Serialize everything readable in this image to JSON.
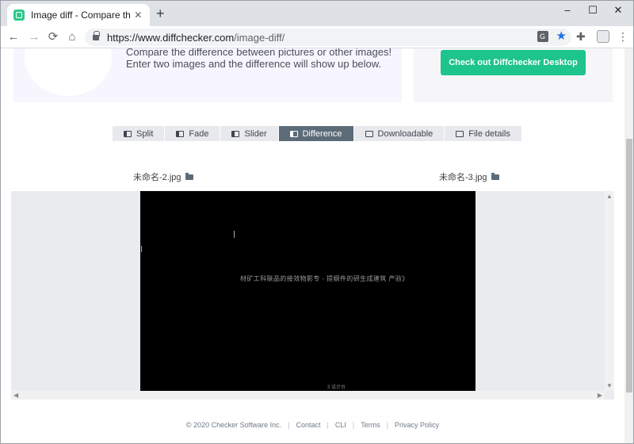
{
  "browser": {
    "tab_title": "Image diff - Compare the differ",
    "tab_close": "✕",
    "new_tab": "+",
    "window_controls": {
      "minimize": "–",
      "maximize": "☐",
      "close": "✕"
    },
    "nav": {
      "back": "←",
      "forward": "→",
      "reload": "⟳",
      "home": "⌂"
    },
    "url_host": "https://www.diffchecker.com",
    "url_path": "/image-diff/",
    "translate_icon_text": "G",
    "bookmark_star": "★",
    "extensions_icon": "✚",
    "menu_icon": "⋮",
    "accent_color": "#1a73e8"
  },
  "hero": {
    "line1": "Compare the difference between pictures or other images!",
    "line2": "Enter two images and the difference will show up below."
  },
  "promo": {
    "button_label": "Check out Diffchecker Desktop",
    "button_color": "#1dc48c"
  },
  "view_tabs": [
    {
      "label": "Split",
      "icon": "split-icon",
      "active": false
    },
    {
      "label": "Fade",
      "icon": "fade-icon",
      "active": false
    },
    {
      "label": "Slider",
      "icon": "slider-icon",
      "active": false
    },
    {
      "label": "Difference",
      "icon": "difference-icon",
      "active": true
    },
    {
      "label": "Downloadable",
      "icon": "download-icon",
      "active": false
    },
    {
      "label": "File details",
      "icon": "file-details-icon",
      "active": false
    }
  ],
  "files": {
    "left": "未命名-2.jpg",
    "right": "未命名-3.jpg"
  },
  "diff": {
    "text_line": "材矿工科联品的接效物影专 - 提纲件的研生成建筑 产验》",
    "footer_text": "3        设计台"
  },
  "footer": {
    "copyright": "© 2020 Checker Software Inc.",
    "links": [
      "Contact",
      "CLI",
      "Terms",
      "Privacy Policy"
    ]
  }
}
